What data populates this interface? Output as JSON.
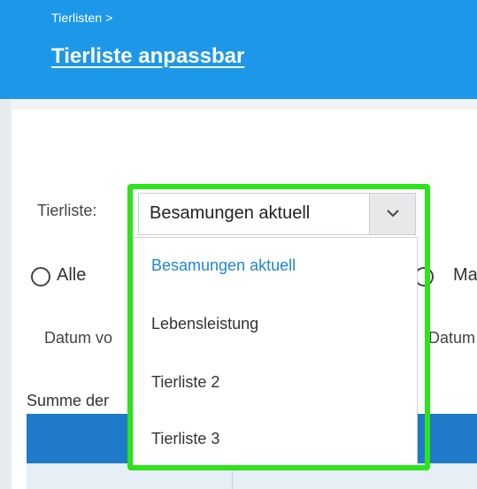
{
  "header": {
    "breadcrumb": "Tierlisten >",
    "title": "Tierliste anpassbar"
  },
  "form": {
    "tierliste_label": "Tierliste:",
    "select_value": "Besamungen aktuell",
    "radio_alle_label": "Alle",
    "radio_right_label": "Ma",
    "datum_left_label": "Datum vo",
    "datum_right_label": "Datum",
    "summe_label": "Summe der"
  },
  "dropdown": {
    "options": [
      "Besamungen aktuell",
      "Lebensleistung",
      "Tierliste 2",
      "Tierliste 3"
    ]
  },
  "colors": {
    "header_bg": "#1d98e8",
    "selected_option": "#1f86d6",
    "table_head": "#1f7ac9",
    "highlight": "#2ee21c"
  }
}
